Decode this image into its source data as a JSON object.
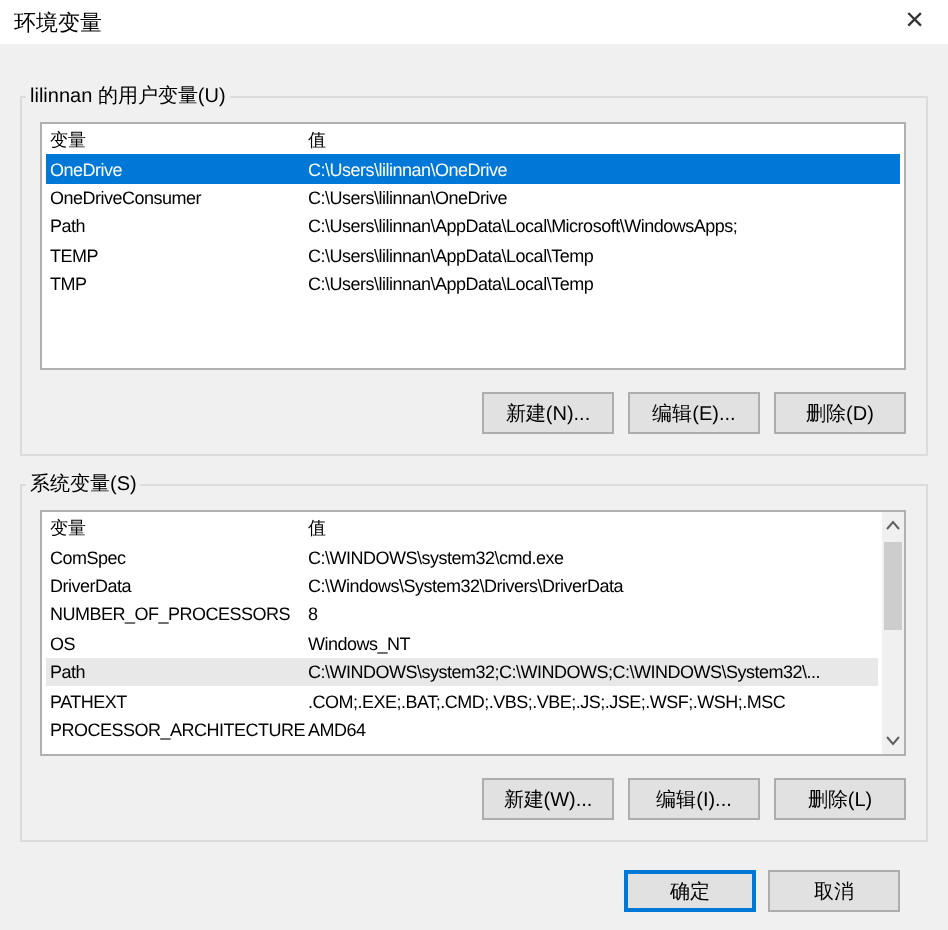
{
  "window": {
    "title": "环境变量",
    "close": "×"
  },
  "user_vars": {
    "label": "lilinnan 的用户变量(U)",
    "columns": [
      "变量",
      "值"
    ],
    "rows": [
      {
        "name": "OneDrive",
        "value": "C:\\Users\\lilinnan\\OneDrive",
        "selected": true
      },
      {
        "name": "OneDriveConsumer",
        "value": "C:\\Users\\lilinnan\\OneDrive",
        "selected": false
      },
      {
        "name": "Path",
        "value": "C:\\Users\\lilinnan\\AppData\\Local\\Microsoft\\WindowsApps;",
        "selected": false
      },
      {
        "name": "TEMP",
        "value": "C:\\Users\\lilinnan\\AppData\\Local\\Temp",
        "selected": false
      },
      {
        "name": "TMP",
        "value": "C:\\Users\\lilinnan\\AppData\\Local\\Temp",
        "selected": false
      }
    ],
    "buttons": [
      "新建(N)...",
      "编辑(E)...",
      "删除(D)"
    ]
  },
  "system_vars": {
    "label": "系统变量(S)",
    "columns": [
      "变量",
      "值"
    ],
    "rows": [
      {
        "name": "ComSpec",
        "value": "C:\\WINDOWS\\system32\\cmd.exe",
        "selected": false,
        "hovered": false
      },
      {
        "name": "DriverData",
        "value": "C:\\Windows\\System32\\Drivers\\DriverData",
        "selected": false,
        "hovered": false
      },
      {
        "name": "NUMBER_OF_PROCESSORS",
        "value": "8",
        "selected": false,
        "hovered": false
      },
      {
        "name": "OS",
        "value": "Windows_NT",
        "selected": false,
        "hovered": false
      },
      {
        "name": "Path",
        "value": "C:\\WINDOWS\\system32;C:\\WINDOWS;C:\\WINDOWS\\System32\\...",
        "selected": false,
        "hovered": true
      },
      {
        "name": "PATHEXT",
        "value": ".COM;.EXE;.BAT;.CMD;.VBS;.VBE;.JS;.JSE;.WSF;.WSH;.MSC",
        "selected": false,
        "hovered": false
      },
      {
        "name": "PROCESSOR_ARCHITECTURE",
        "value": "AMD64",
        "selected": false,
        "hovered": false
      }
    ],
    "buttons": [
      "新建(W)...",
      "编辑(I)...",
      "删除(L)"
    ]
  },
  "footer_buttons": [
    {
      "label": "确定",
      "default": true
    },
    {
      "label": "取消",
      "default": false
    }
  ]
}
